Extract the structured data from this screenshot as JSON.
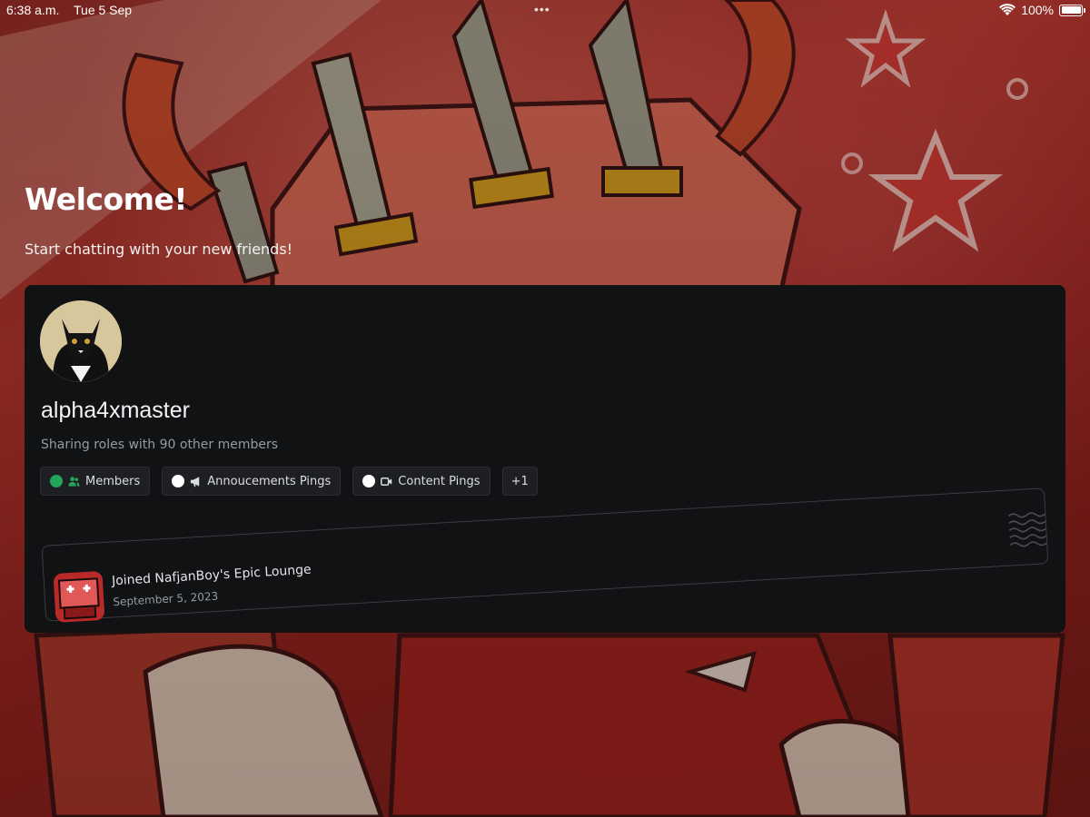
{
  "status_bar": {
    "time": "6:38 a.m.",
    "date": "Tue 5 Sep",
    "dots": "•••",
    "battery": "100%"
  },
  "welcome": {
    "title": "Welcome!",
    "subtitle": "Start chatting with your new friends!"
  },
  "profile": {
    "username": "alpha4xmaster",
    "shared_roles_text": "Sharing roles with 90 other members",
    "roles": [
      {
        "label": "Members",
        "dot_color": "#23a55a",
        "icon": "members-icon"
      },
      {
        "label": "Annoucements Pings",
        "dot_color": "#ffffff",
        "icon": "megaphone-icon"
      },
      {
        "label": "Content Pings",
        "dot_color": "#ffffff",
        "icon": "video-icon"
      }
    ],
    "more_roles": "+1"
  },
  "join": {
    "text": "Joined NafjanBoy's Epic Lounge",
    "date": "September 5, 2023"
  },
  "colors": {
    "card_bg": "#111214",
    "chip_bg": "#1e1f22",
    "muted_text": "#949ba4",
    "online_green": "#23a55a"
  }
}
